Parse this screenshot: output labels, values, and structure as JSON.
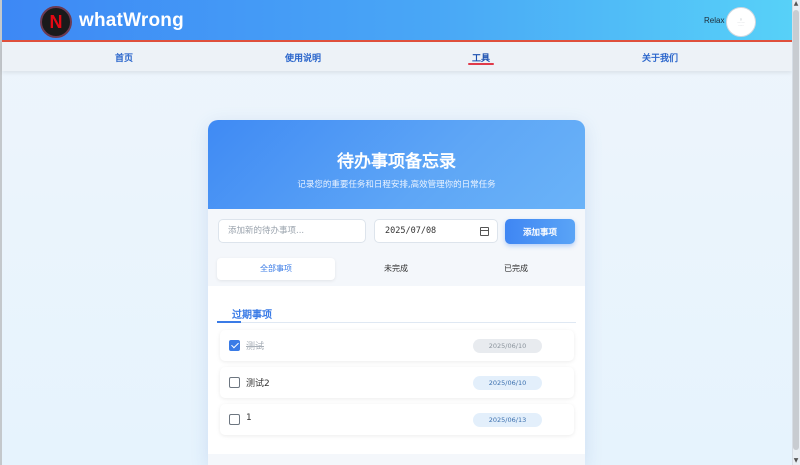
{
  "header": {
    "brand": "whatWrong",
    "logo_letter": "N",
    "user_name": "Relax",
    "avatar_lines": [
      "○",
      "··········",
      "·······"
    ]
  },
  "nav": {
    "items": [
      {
        "label": "首页"
      },
      {
        "label": "使用说明"
      },
      {
        "label": "工具"
      },
      {
        "label": "关于我们"
      }
    ],
    "active_index": 2
  },
  "card": {
    "title": "待办事项备忘录",
    "subtitle": "记录您的重要任务和日程安排,高效管理你的日常任务",
    "input_placeholder": "添加新的待办事项...",
    "date_value": "2025/07/08",
    "add_button": "添加事项",
    "tabs": [
      {
        "label": "全部事项",
        "active": true
      },
      {
        "label": "未完成",
        "active": false
      },
      {
        "label": "已完成",
        "active": false
      }
    ],
    "section_title": "过期事项",
    "items": [
      {
        "text": "测试",
        "date": "2025/06/10",
        "done": true
      },
      {
        "text": "测试2",
        "date": "2025/06/10",
        "done": false
      },
      {
        "text": "1",
        "date": "2025/06/13",
        "done": false
      }
    ]
  },
  "colors": {
    "accent": "#3a7be6",
    "header_gradient_start": "#3d88f5",
    "header_gradient_end": "#57d1f8",
    "nav_underline": "#e03b4a"
  }
}
